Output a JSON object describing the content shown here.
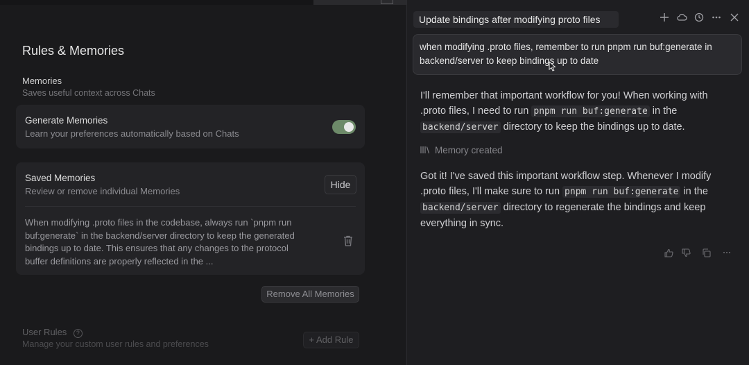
{
  "settings": {
    "page_title": "Rules & Memories",
    "memories": {
      "title": "Memories",
      "subtitle": "Saves useful context across Chats"
    },
    "generate_memories": {
      "title": "Generate Memories",
      "subtitle": "Learn your preferences automatically based on Chats",
      "enabled": true
    },
    "saved_memories": {
      "title": "Saved Memories",
      "subtitle": "Review or remove individual Memories",
      "hide_label": "Hide",
      "items": [
        {
          "text": "When modifying .proto files in the codebase, always run `pnpm run buf:generate` in the backend/server directory to keep the generated bindings up to date. This ensures that any changes to the protocol buffer definitions are properly reflected in the ..."
        }
      ]
    },
    "remove_all_label": "Remove All Memories",
    "user_rules": {
      "title": "User Rules",
      "subtitle": "Manage your custom user rules and preferences",
      "add_rule_label": "+ Add Rule"
    }
  },
  "chat": {
    "title": "Update bindings after modifying proto files",
    "user_message": "when modifying .proto files, remember to run pnpm run buf:generate in backend/server to keep bindings up to date",
    "assistant_1": {
      "t1": "I'll remember that important workflow for you! When working with .proto files, I need to run ",
      "code1": "pnpm run buf:generate",
      "t2": " in the ",
      "code2": "backend/server",
      "t3": " directory to keep the bindings up to date."
    },
    "memory_created": "Memory created",
    "assistant_2": {
      "t1": "Got it! I've saved this important workflow step. Whenever I modify .proto files, I'll make sure to run ",
      "code1": "pnpm run buf:generate",
      "t2": " in the ",
      "code2": "backend/server",
      "t3": " directory to regenerate the bindings and keep everything in sync."
    }
  },
  "icons": {
    "new_chat": "plus-icon",
    "cloud": "cloud-icon",
    "history": "history-icon",
    "more": "more-icon",
    "close": "close-icon",
    "thumbs_up": "thumbs-up-icon",
    "thumbs_down": "thumbs-down-icon",
    "copy": "copy-icon",
    "trash": "trash-icon"
  },
  "colors": {
    "toggle_on": "#6d8a69",
    "background": "#1b1b1d"
  }
}
